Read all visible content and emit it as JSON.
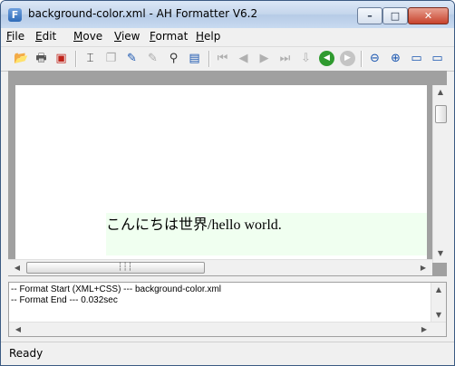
{
  "window": {
    "title": "background-color.xml - AH Formatter V6.2",
    "app_icon": "ah-formatter-app-icon",
    "minimize_glyph": "–",
    "maximize_glyph": "□",
    "close_glyph": "✕"
  },
  "menu": {
    "items": [
      {
        "label": "File",
        "accel": "F",
        "rest": "ile"
      },
      {
        "label": "Edit",
        "accel": "E",
        "rest": "dit"
      },
      {
        "label": "Move",
        "accel": "M",
        "rest": "ove"
      },
      {
        "label": "View",
        "accel": "V",
        "rest": "iew"
      },
      {
        "label": "Format",
        "accel": "F",
        "rest": "ormat"
      },
      {
        "label": "Help",
        "accel": "H",
        "rest": "elp"
      }
    ]
  },
  "toolbar": {
    "icons": [
      {
        "name": "open-folder-icon",
        "glyph": "📂"
      },
      {
        "name": "print-icon",
        "glyph": "🖶"
      },
      {
        "name": "pdf-icon",
        "glyph": "▣"
      },
      {
        "name": "select-cursor-icon",
        "glyph": "⌶"
      },
      {
        "name": "copy-icon",
        "glyph": "❐"
      },
      {
        "name": "edit-check-icon",
        "glyph": "✎"
      },
      {
        "name": "edit-disabled-icon",
        "glyph": "✎"
      },
      {
        "name": "find-binoculars-icon",
        "glyph": "⚲"
      },
      {
        "name": "format-image-icon",
        "glyph": "▤"
      },
      {
        "name": "first-page-icon",
        "glyph": "⏮"
      },
      {
        "name": "previous-page-icon",
        "glyph": "◀"
      },
      {
        "name": "next-page-icon",
        "glyph": "▶"
      },
      {
        "name": "last-page-icon",
        "glyph": "⏭"
      },
      {
        "name": "page-jump-icon",
        "glyph": "⇩"
      },
      {
        "name": "back-green-icon",
        "glyph": "◀"
      },
      {
        "name": "forward-gray-icon",
        "glyph": "▶"
      },
      {
        "name": "zoom-out-icon",
        "glyph": "⊖"
      },
      {
        "name": "zoom-in-icon",
        "glyph": "⊕"
      },
      {
        "name": "fit-page-icon",
        "glyph": "▭"
      },
      {
        "name": "fit-width-icon",
        "glyph": "▭"
      }
    ],
    "colors": {
      "enabled": "#1a56b0",
      "disabled": "#b0b0b0",
      "green": "#2f9a2f",
      "red": "#c0241b"
    }
  },
  "document": {
    "text_japanese": "こんにちは世界",
    "text_latin": "/hello world.",
    "block_background": "#f0fff0"
  },
  "log": {
    "lines": [
      "-- Format Start (XML+CSS) --- background-color.xml",
      "-- Format End ---  0.032sec"
    ]
  },
  "status": {
    "text": "Ready"
  }
}
